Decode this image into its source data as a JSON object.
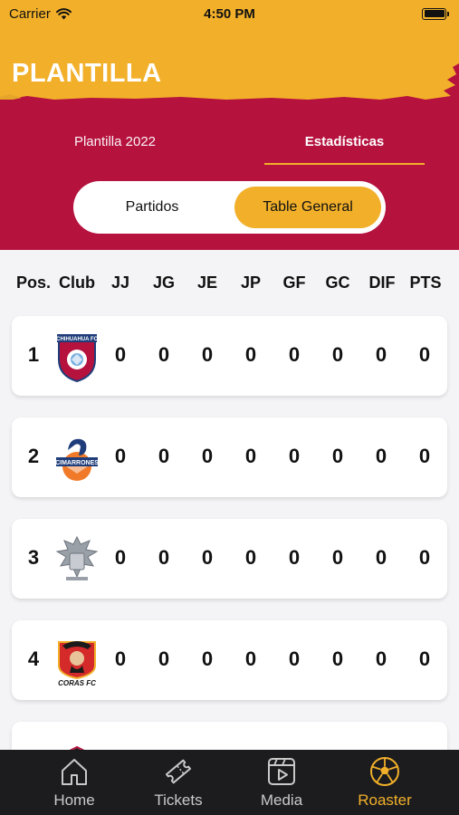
{
  "status_bar": {
    "carrier": "Carrier",
    "time": "4:50 PM"
  },
  "header": {
    "title": "PLANTILLA"
  },
  "tabs": [
    {
      "label": "Plantilla 2022",
      "active": false
    },
    {
      "label": "Estadísticas",
      "active": true
    }
  ],
  "segmented": {
    "options": [
      "Partidos",
      "Table General"
    ],
    "selected": "Table General"
  },
  "table": {
    "headers": [
      "Pos.",
      "Club",
      "JJ",
      "JG",
      "JE",
      "JP",
      "GF",
      "GC",
      "DIF",
      "PTS"
    ],
    "rows": [
      {
        "pos": "1",
        "logo": "chihuahua-fc-crest",
        "logo_text": "CHIHUAHUA FC",
        "jj": "0",
        "jg": "0",
        "je": "0",
        "jp": "0",
        "gf": "0",
        "gc": "0",
        "dif": "0",
        "pts": "0"
      },
      {
        "pos": "2",
        "logo": "cimarrones-crest",
        "logo_text": "CIMARRONES",
        "jj": "0",
        "jg": "0",
        "je": "0",
        "jp": "0",
        "gf": "0",
        "gc": "0",
        "dif": "0",
        "pts": "0"
      },
      {
        "pos": "3",
        "logo": "eagle-coat-of-arms-crest",
        "jj": "0",
        "jg": "0",
        "je": "0",
        "jp": "0",
        "gf": "0",
        "gc": "0",
        "dif": "0",
        "pts": "0"
      },
      {
        "pos": "4",
        "logo": "coras-fc-crest",
        "logo_text": "CORAS FC",
        "jj": "0",
        "jg": "0",
        "je": "0",
        "jp": "0",
        "gf": "0",
        "gc": "0",
        "dif": "0",
        "pts": "0"
      }
    ]
  },
  "tabbar": {
    "items": [
      {
        "label": "Home",
        "icon": "home-icon",
        "active": false
      },
      {
        "label": "Tickets",
        "icon": "ticket-icon",
        "active": false
      },
      {
        "label": "Media",
        "icon": "media-play-icon",
        "active": false
      },
      {
        "label": "Roaster",
        "icon": "soccer-ball-icon",
        "active": true
      }
    ]
  },
  "colors": {
    "brand_yellow": "#f2b02a",
    "brand_red": "#b5123e",
    "tabbar_bg": "#1c1c1e",
    "list_bg": "#f4f4f6"
  }
}
